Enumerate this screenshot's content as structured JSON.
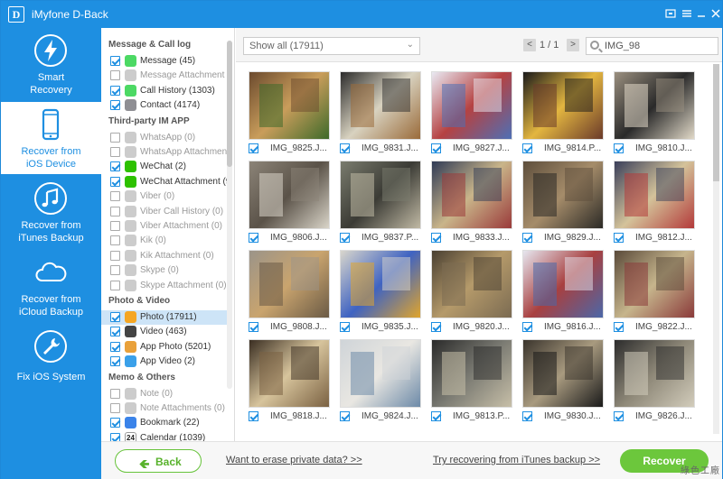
{
  "window": {
    "title": "iMyfone D-Back",
    "logo_letter": "D"
  },
  "sidebar": {
    "items": [
      {
        "label1": "Smart",
        "label2": "Recovery",
        "icon": "lightning-icon",
        "active": false
      },
      {
        "label1": "Recover from",
        "label2": "iOS Device",
        "icon": "phone-icon",
        "active": true
      },
      {
        "label1": "Recover from",
        "label2": "iTunes Backup",
        "icon": "music-note-icon",
        "active": false
      },
      {
        "label1": "Recover from",
        "label2": "iCloud Backup",
        "icon": "cloud-icon",
        "active": false
      },
      {
        "label1": "Fix iOS System",
        "label2": "",
        "icon": "wrench-icon",
        "active": false
      }
    ]
  },
  "categories": {
    "groups": [
      {
        "title": "Message & Call log",
        "items": [
          {
            "label": "Message (45)",
            "checked": true,
            "enabled": true,
            "color": "#4cd964"
          },
          {
            "label": "Message Attachment (0)",
            "checked": false,
            "enabled": false,
            "color": "#4cd964"
          },
          {
            "label": "Call History (1303)",
            "checked": true,
            "enabled": true,
            "color": "#4cd964"
          },
          {
            "label": "Contact (4174)",
            "checked": true,
            "enabled": true,
            "color": "#8e8e93"
          }
        ]
      },
      {
        "title": "Third-party IM APP",
        "items": [
          {
            "label": "WhatsApp (0)",
            "checked": false,
            "enabled": false,
            "color": "#25d366"
          },
          {
            "label": "WhatsApp Attachment (0)",
            "checked": false,
            "enabled": false,
            "color": "#25d366"
          },
          {
            "label": "WeChat (2)",
            "checked": true,
            "enabled": true,
            "color": "#2dc100"
          },
          {
            "label": "WeChat Attachment (9)",
            "checked": true,
            "enabled": true,
            "color": "#2dc100"
          },
          {
            "label": "Viber (0)",
            "checked": false,
            "enabled": false,
            "color": "#7b519d"
          },
          {
            "label": "Viber Call History (0)",
            "checked": false,
            "enabled": false,
            "color": "#7b519d"
          },
          {
            "label": "Viber Attachment (0)",
            "checked": false,
            "enabled": false,
            "color": "#7b519d"
          },
          {
            "label": "Kik (0)",
            "checked": false,
            "enabled": false,
            "color": "#82bc23"
          },
          {
            "label": "Kik Attachment (0)",
            "checked": false,
            "enabled": false,
            "color": "#82bc23"
          },
          {
            "label": "Skype (0)",
            "checked": false,
            "enabled": false,
            "color": "#00aff0"
          },
          {
            "label": "Skype Attachment (0)",
            "checked": false,
            "enabled": false,
            "color": "#00aff0"
          }
        ]
      },
      {
        "title": "Photo & Video",
        "items": [
          {
            "label": "Photo (17911)",
            "checked": true,
            "enabled": true,
            "color": "#f5a623",
            "selected": true
          },
          {
            "label": "Video (463)",
            "checked": true,
            "enabled": true,
            "color": "#444444"
          },
          {
            "label": "App Photo (5201)",
            "checked": true,
            "enabled": true,
            "color": "#e9a13b"
          },
          {
            "label": "App Video (2)",
            "checked": true,
            "enabled": true,
            "color": "#3aa0e9"
          }
        ]
      },
      {
        "title": "Memo & Others",
        "items": [
          {
            "label": "Note (0)",
            "checked": false,
            "enabled": false,
            "color": "#f7d23e"
          },
          {
            "label": "Note Attachments (0)",
            "checked": false,
            "enabled": false,
            "color": "#f7d23e"
          },
          {
            "label": "Bookmark (22)",
            "checked": true,
            "enabled": true,
            "color": "#3a83e9"
          },
          {
            "label": "Calendar (1039)",
            "checked": true,
            "enabled": true,
            "color": "#ffffff",
            "calendar_day": "24"
          }
        ]
      }
    ]
  },
  "toolbar": {
    "filter_value": "Show all (17911)",
    "page_prev": "<",
    "page_info": "1 / 1",
    "page_next": ">",
    "search_value": "IMG_98"
  },
  "photos": [
    {
      "name": "IMG_9825.J...",
      "colors": [
        "#6b4a2e",
        "#c99d5b",
        "#3e6a2a"
      ]
    },
    {
      "name": "IMG_9831.J...",
      "colors": [
        "#2c2c2c",
        "#d8d2c0",
        "#9a6b3a"
      ]
    },
    {
      "name": "IMG_9827.J...",
      "colors": [
        "#e9e9f2",
        "#b54242",
        "#4e6fb5"
      ]
    },
    {
      "name": "IMG_9814.P...",
      "colors": [
        "#1a1a1a",
        "#e3b640",
        "#6a3a2a"
      ]
    },
    {
      "name": "IMG_9810.J...",
      "colors": [
        "#9a8f7f",
        "#2a2a2a",
        "#e1d9c8"
      ]
    },
    {
      "name": "IMG_9806.J...",
      "colors": [
        "#8c8478",
        "#5a5248",
        "#d9d4c8"
      ]
    },
    {
      "name": "IMG_9837.P...",
      "colors": [
        "#7a7c6e",
        "#3b3b35",
        "#c0b9a4"
      ]
    },
    {
      "name": "IMG_9833.J...",
      "colors": [
        "#2f3a55",
        "#c9b58a",
        "#9a3a3a"
      ]
    },
    {
      "name": "IMG_9829.J...",
      "colors": [
        "#5d4e3c",
        "#a58c6a",
        "#2c2a26"
      ]
    },
    {
      "name": "IMG_9812.J...",
      "colors": [
        "#3a3f5a",
        "#d4c39a",
        "#b33a3a"
      ]
    },
    {
      "name": "IMG_9808.J...",
      "colors": [
        "#9b9489",
        "#c9a46e",
        "#6a5a45"
      ]
    },
    {
      "name": "IMG_9835.J...",
      "colors": [
        "#d9d6cc",
        "#3f63c2",
        "#e0a52d"
      ]
    },
    {
      "name": "IMG_9820.J...",
      "colors": [
        "#4a4032",
        "#b59a6a",
        "#7b6b52"
      ]
    },
    {
      "name": "IMG_9816.J...",
      "colors": [
        "#e6e6ef",
        "#a84040",
        "#4b67a8"
      ]
    },
    {
      "name": "IMG_9822.J...",
      "colors": [
        "#5a4a3a",
        "#c6b58c",
        "#8a3a3a"
      ]
    },
    {
      "name": "IMG_9818.J...",
      "colors": [
        "#3a2e22",
        "#d7c49c",
        "#7a6142"
      ]
    },
    {
      "name": "IMG_9824.J...",
      "colors": [
        "#cfd4d8",
        "#e9e7e2",
        "#6d8aa8"
      ]
    },
    {
      "name": "IMG_9813.P...",
      "colors": [
        "#2a2a2a",
        "#7a7a72",
        "#c7bfa8"
      ]
    },
    {
      "name": "IMG_9830.J...",
      "colors": [
        "#3a342c",
        "#a89a7f",
        "#1a1a1a"
      ]
    },
    {
      "name": "IMG_9826.J...",
      "colors": [
        "#2c2c2c",
        "#8e8878",
        "#d2ccbb"
      ]
    }
  ],
  "bottom": {
    "back_label": "Back",
    "erase_link": "Want to erase private data? >>",
    "itunes_link": "Try recovering from iTunes backup >>",
    "recover_label": "Recover"
  },
  "watermark": "綠色工廠",
  "colors": {
    "accent": "#1e8fe1",
    "recover_green": "#6cc73c"
  }
}
